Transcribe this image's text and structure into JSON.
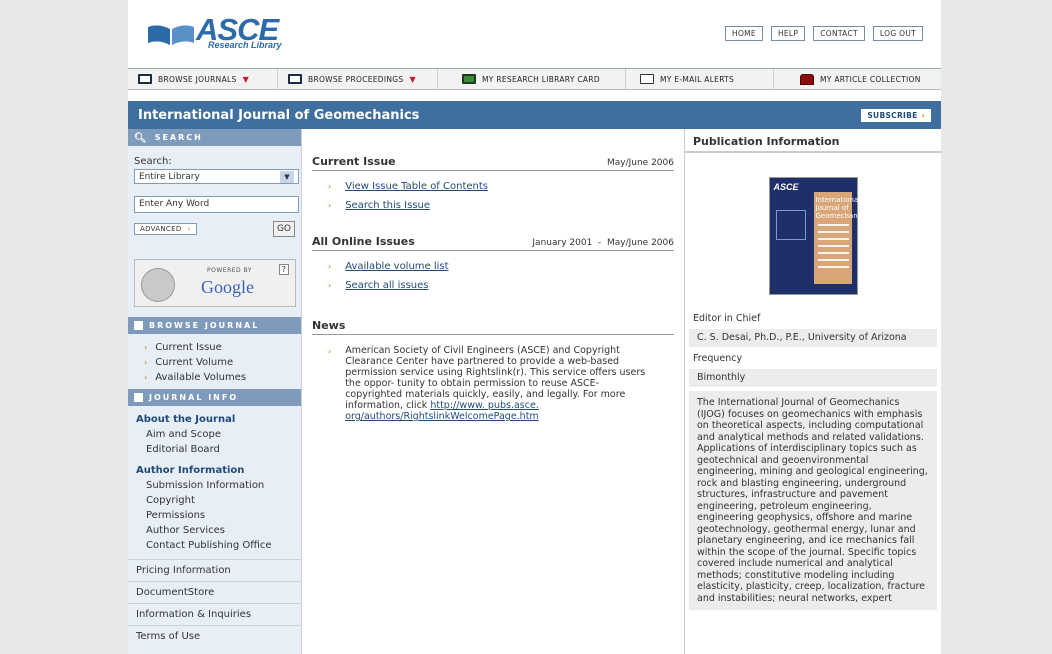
{
  "header": {
    "logo_brand": "ASCE",
    "logo_sub": "Research Library",
    "toplinks": [
      "HOME",
      "HELP",
      "CONTACT",
      "LOG OUT"
    ]
  },
  "toolbar": {
    "items": [
      "BROWSE JOURNALS",
      "BROWSE PROCEEDINGS",
      "MY RESEARCH LIBRARY CARD",
      "MY E-MAIL ALERTS",
      "MY ARTICLE COLLECTION"
    ]
  },
  "titlebar": {
    "title": "International Journal of Geomechanics",
    "subscribe": "SUBSCRIBE"
  },
  "sidebar": {
    "search_head": "SEARCH",
    "search_label": "Search:",
    "scope_value": "Entire Library",
    "query_placeholder": "Enter Any Word",
    "advanced": "ADVANCED",
    "go": "GO",
    "google_powered": "POWERED BY",
    "google_name": "Google",
    "browse_head": "BROWSE JOURNAL",
    "browse_items": [
      "Current Issue",
      "Current Volume",
      "Available Volumes"
    ],
    "info_head": "JOURNAL INFO",
    "about_head": "About the Journal",
    "about_items": [
      "Aim and Scope",
      "Editorial Board"
    ],
    "author_head": "Author Information",
    "author_items": [
      "Submission Information",
      "Copyright",
      "Permissions",
      "Author Services",
      "Contact Publishing Office"
    ],
    "bottom_links": [
      "Pricing Information",
      "DocumentStore",
      "Information & Inquiries",
      "Terms of Use"
    ]
  },
  "main": {
    "current": {
      "title": "Current Issue",
      "date": "May/June 2006",
      "links": [
        "View Issue Table of Contents",
        "Search this Issue"
      ]
    },
    "online": {
      "title": "All Online Issues",
      "date": "January 2001  -  May/June 2006",
      "links": [
        "Available volume list",
        "Search all issues"
      ]
    },
    "news": {
      "title": "News",
      "text": "American Society of Civil Engineers (ASCE) and Copyright Clearance Center have partnered to provide a web-based permission service using Rightslink(r). This service offers users the oppor- tunity to obtain permission to reuse ASCE- copyrighted materials quickly, easily, and legally. For more information, click ",
      "link": "http://www. pubs.asce. org/authors/RightslinkWelcomePage.htm"
    }
  },
  "pubinfo": {
    "title": "Publication Information",
    "cover_tag": "ASCE",
    "cover_name": "International Journal of Geomechanics",
    "editor_label": "Editor in Chief",
    "editor_value": "C. S. Desai, Ph.D., P.E., University of Arizona",
    "freq_label": "Frequency",
    "freq_value": "Bimonthly",
    "description": "The International Journal of Geomechanics (IJOG) focuses on geomechanics with emphasis on theoretical aspects, including computational and analytical methods and related validations. Applications of interdisciplinary topics such as geotechnical and geoenvironmental engineering, mining and geological engineering, rock and blasting engineering, underground structures, infrastructure and pavement engineering, petroleum engineering, engineering geophysics, offshore and marine geotechnology, geothermal energy, lunar and planetary engineering, and ice mechanics fall within the scope of the journal. Specific topics covered include numerical and analytical methods; constitutive modeling including elasticity, plasticity, creep, localization, fracture and instabilities; neural networks, expert"
  },
  "colors": {
    "accent": "#3f6f9f",
    "bullet": "#e07000",
    "brand": "#2c6aa8"
  }
}
